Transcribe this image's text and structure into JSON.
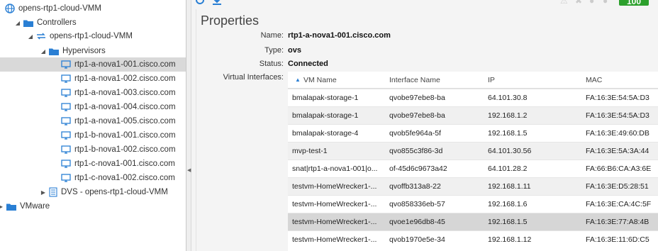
{
  "tree": {
    "root": "opens-rtp1-cloud-VMM",
    "controllers": "Controllers",
    "controller": "opens-rtp1-cloud-VMM",
    "hypervisors": "Hypervisors",
    "hosts": [
      "rtp1-a-nova1-001.cisco.com",
      "rtp1-a-nova1-002.cisco.com",
      "rtp1-a-nova1-003.cisco.com",
      "rtp1-a-nova1-004.cisco.com",
      "rtp1-a-nova1-005.cisco.com",
      "rtp1-b-nova1-001.cisco.com",
      "rtp1-b-nova1-002.cisco.com",
      "rtp1-c-nova1-001.cisco.com",
      "rtp1-c-nova1-002.cisco.com"
    ],
    "dvs": "DVS - opens-rtp1-cloud-VMM",
    "vmware": "VMware"
  },
  "toolbar": {
    "badge_text": "100",
    "badge_color": "#2ca02c"
  },
  "properties": {
    "title": "Properties",
    "name_label": "Name:",
    "name_value": "rtp1-a-nova1-001.cisco.com",
    "type_label": "Type:",
    "type_value": "ovs",
    "status_label": "Status:",
    "status_value": "Connected",
    "vif_label": "Virtual Interfaces:"
  },
  "table": {
    "columns": [
      "VM Name",
      "Interface Name",
      "IP",
      "MAC"
    ],
    "rows": [
      [
        "bmalapak-storage-1",
        "qvobe97ebe8-ba",
        "64.101.30.8",
        "FA:16:3E:54:5A:D3"
      ],
      [
        "bmalapak-storage-1",
        "qvobe97ebe8-ba",
        "192.168.1.2",
        "FA:16:3E:54:5A:D3"
      ],
      [
        "bmalapak-storage-4",
        "qvob5fe964a-5f",
        "192.168.1.5",
        "FA:16:3E:49:60:DB"
      ],
      [
        "mvp-test-1",
        "qvo855c3f86-3d",
        "64.101.30.56",
        "FA:16:3E:5A:3A:44"
      ],
      [
        "snat|rtp1-a-nova1-001|o...",
        "of-45d6c9673a42",
        "64.101.28.2",
        "FA:66:B6:CA:A3:6E"
      ],
      [
        "testvm-HomeWrecker1-...",
        "qvoffb313a8-22",
        "192.168.1.11",
        "FA:16:3E:D5:28:51"
      ],
      [
        "testvm-HomeWrecker1-...",
        "qvo858336eb-57",
        "192.168.1.6",
        "FA:16:3E:CA:4C:5F"
      ],
      [
        "testvm-HomeWrecker1-...",
        "qvoe1e96db8-45",
        "192.168.1.5",
        "FA:16:3E:77:A8:4B"
      ],
      [
        "testvm-HomeWrecker1-...",
        "qvob1970e5e-34",
        "192.168.1.12",
        "FA:16:3E:11:6D:C5"
      ]
    ]
  }
}
